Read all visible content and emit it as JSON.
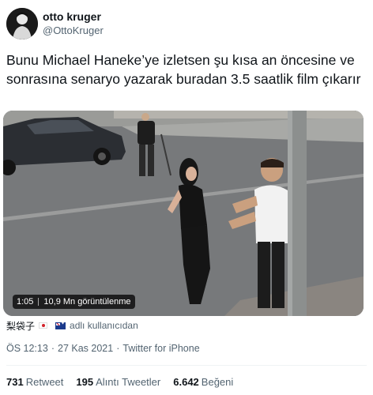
{
  "author": {
    "name": "otto kruger",
    "handle": "@OttoKruger",
    "avatar_icon": "profile-photo"
  },
  "tweet": {
    "text": "Bunu Michael Haneke’ye izletsen şu kısa an öncesine ve sonrasına senaryo yazarak buradan 3.5 saatlik film çıkarır"
  },
  "media": {
    "type": "video",
    "duration": "1:05",
    "views": "10,9 Mn görüntülenme"
  },
  "tagged": {
    "name": "梨袋子",
    "flags": [
      "japan-flag-icon",
      "australia-flag-icon"
    ],
    "user_icon": "user-icon",
    "label": "adlı kullanıcıdan"
  },
  "meta": {
    "time": "ÖS 12:13",
    "sep1": "·",
    "date": "27 Kas 2021",
    "sep2": "·",
    "source": "Twitter for iPhone"
  },
  "stats": {
    "retweets": "731",
    "retweets_label": "Retweet",
    "quotes": "195",
    "quotes_label": "Alıntı Tweetler",
    "likes": "6.642",
    "likes_label": "Beğeni"
  },
  "colors": {
    "text": "#0f1419",
    "secondary": "#536471",
    "divider": "#eff3f4"
  }
}
